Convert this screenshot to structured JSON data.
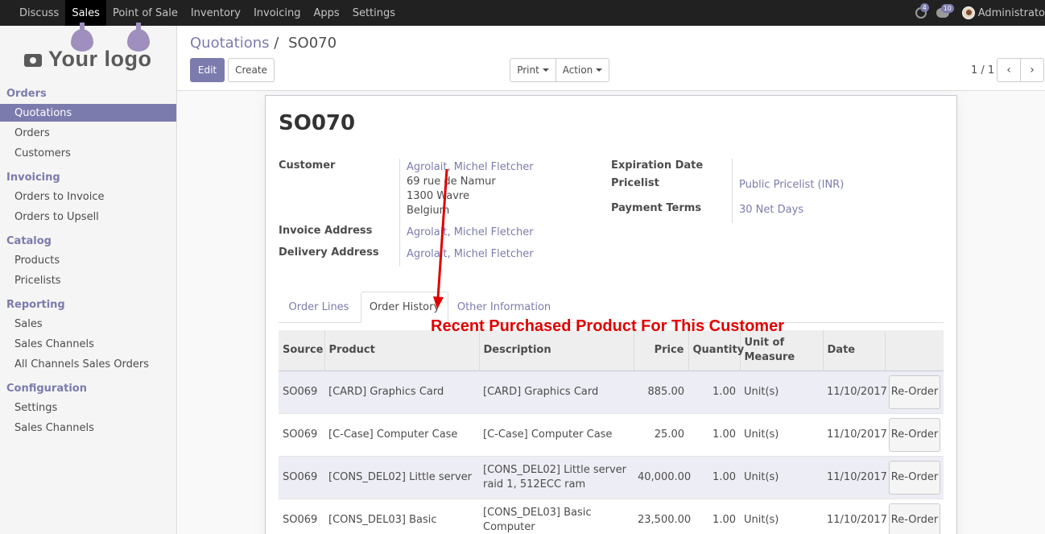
{
  "topnav": {
    "items": [
      "Discuss",
      "Sales",
      "Point of Sale",
      "Inventory",
      "Invoicing",
      "Apps",
      "Settings"
    ],
    "active": "Sales",
    "chat_badge": "4",
    "activity_badge": "10",
    "user": "Administrato"
  },
  "logo": {
    "text": "Your logo"
  },
  "sidebar": {
    "sections": [
      {
        "title": "Orders",
        "items": [
          "Quotations",
          "Orders",
          "Customers"
        ]
      },
      {
        "title": "Invoicing",
        "items": [
          "Orders to Invoice",
          "Orders to Upsell"
        ]
      },
      {
        "title": "Catalog",
        "items": [
          "Products",
          "Pricelists"
        ]
      },
      {
        "title": "Reporting",
        "items": [
          "Sales",
          "Sales Channels",
          "All Channels Sales Orders"
        ]
      },
      {
        "title": "Configuration",
        "items": [
          "Settings",
          "Sales Channels"
        ]
      }
    ],
    "active_item": "Quotations"
  },
  "breadcrumb": {
    "parent": "Quotations",
    "separator": "/",
    "current": "SO070"
  },
  "toolbar": {
    "edit": "Edit",
    "create": "Create",
    "print": "Print",
    "action": "Action"
  },
  "pager": {
    "text": "1 / 1"
  },
  "form": {
    "name": "SO070",
    "customer_label": "Customer",
    "customer": "Agrolait, Michel Fletcher",
    "address": [
      "69 rue de Namur",
      "1300 Wavre",
      "Belgium"
    ],
    "invoice_address_label": "Invoice Address",
    "invoice_address": "Agrolait, Michel Fletcher",
    "delivery_address_label": "Delivery Address",
    "delivery_address": "Agrolait, Michel Fletcher",
    "expiration_label": "Expiration Date",
    "pricelist_label": "Pricelist",
    "pricelist": "Public Pricelist (INR)",
    "payment_terms_label": "Payment Terms",
    "payment_terms": "30 Net Days"
  },
  "tabs": [
    "Order Lines",
    "Order History",
    "Other Information"
  ],
  "active_tab": "Order History",
  "annotation": "Recent Purchased Product For This Customer",
  "history": {
    "columns": [
      "Source",
      "Product",
      "Description",
      "Price",
      "Quantity",
      "Unit of Measure",
      "Date",
      ""
    ],
    "reorder_label": "Re-Order",
    "rows": [
      {
        "source": "SO069",
        "product": "[CARD] Graphics Card",
        "description": "[CARD] Graphics Card",
        "price": "885.00",
        "quantity": "1.00",
        "uom": "Unit(s)",
        "date": "11/10/2017"
      },
      {
        "source": "SO069",
        "product": "[C-Case] Computer Case",
        "description": "[C-Case] Computer Case",
        "price": "25.00",
        "quantity": "1.00",
        "uom": "Unit(s)",
        "date": "11/10/2017"
      },
      {
        "source": "SO069",
        "product": "[CONS_DEL02] Little server",
        "description": "[CONS_DEL02] Little server raid 1, 512ECC ram",
        "price": "40,000.00",
        "quantity": "1.00",
        "uom": "Unit(s)",
        "date": "11/10/2017"
      },
      {
        "source": "SO069",
        "product": "[CONS_DEL03] Basic",
        "description": "[CONS_DEL03] Basic Computer",
        "price": "23,500.00",
        "quantity": "1.00",
        "uom": "Unit(s)",
        "date": "11/10/2017"
      }
    ]
  },
  "colors": {
    "brand": "#7c7bad",
    "topbar": "#212121",
    "annotation": "#e00000"
  }
}
